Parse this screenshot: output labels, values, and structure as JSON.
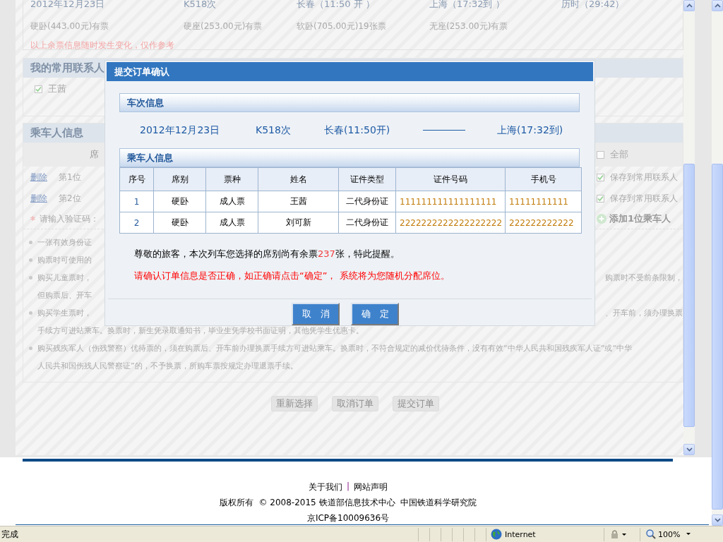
{
  "background_page": {
    "train_summary": {
      "date": "2012年12月23日",
      "train": "K518次",
      "depart": "长春（11:50 开 ）",
      "arrive": "上海（17:32到 ）",
      "duration": "历时（29:42）"
    },
    "seats": [
      "硬卧(443.00元)有票",
      "硬座(253.00元)有票",
      "软卧(705.00元)19张票",
      "无座(253.00元)有票"
    ],
    "seat_note": "以上余票信息随时发生变化，仅作参考",
    "contacts_section": {
      "title": "我的常用联系人",
      "contacts": [
        {
          "name": "王茜",
          "checked": true
        }
      ]
    },
    "passengers_section": {
      "title": "乘车人信息",
      "column_1": "席",
      "select_all": {
        "label": "全部",
        "checked": false
      },
      "rows": [
        {
          "delete": "删除",
          "position": "第1位",
          "save": {
            "label": "保存到常用联系人",
            "checked": true
          }
        },
        {
          "delete": "删除",
          "position": "第2位",
          "save": {
            "label": "保存到常用联系人",
            "checked": true
          }
        }
      ],
      "captcha_label": "请输入验证码：",
      "add_passenger": "添加1位乘车人"
    },
    "notes": [
      {
        "bullet": true,
        "left": "一张有效身份证"
      },
      {
        "bullet": true,
        "left": "购票时可使用的"
      },
      {
        "bullet": true,
        "left": "购买儿童票时，",
        "right": "购票时不受前条限制，"
      },
      {
        "bullet": false,
        "left": "但购票后、开车"
      },
      {
        "bullet": true,
        "left": "购买学生票时，",
        "right": "、开车前，须办理换票"
      },
      {
        "bullet": false,
        "left": "手续方可进站乘车。换票时，新生凭录取通知书，毕业生凭学校书面证明，其他凭学生优惠卡。"
      },
      {
        "bullet": true,
        "left": "购买残疾军人（伤残警察）优待票的，须在购票后、开车前办理换票手续方可进站乘车。换票时，不符合规定的减价优待条件，没有有效“中华人民共和国残疾军人证“或“中华"
      },
      {
        "bullet": false,
        "left": "人民共和国伤残人民警察证”的，不予换票，所购车票按规定办理退票手续。"
      }
    ],
    "buttons": [
      "重新选择",
      "取消订单",
      "提交订单"
    ]
  },
  "modal": {
    "title": "提交订单确认",
    "train_section": {
      "title": "车次信息",
      "date": "2012年12月23日",
      "train": "K518次",
      "depart": "长春(11:50开)",
      "arrive": "上海(17:32到)"
    },
    "passenger_section": {
      "title": "乘车人信息",
      "columns": [
        "序号",
        "席别",
        "票种",
        "姓名",
        "证件类型",
        "证件号码",
        "手机号"
      ],
      "rows": [
        [
          "1",
          "硬卧",
          "成人票",
          "王茜",
          "二代身份证",
          "111111111111111111",
          "11111111111"
        ],
        [
          "2",
          "硬卧",
          "成人票",
          "刘可新",
          "二代身份证",
          "2222222222222222222",
          "222222222222"
        ]
      ]
    },
    "notice": {
      "before": "尊敬的旅客，本次列车您选择的席别尚有余票",
      "count": "237",
      "after": "张，特此提醒。"
    },
    "warning": "请确认订单信息是否正确，如正确请点击“确定”， 系统将为您随机分配席位。",
    "buttons": [
      "取　消",
      "确　定"
    ]
  },
  "footer": {
    "links": [
      "关于我们",
      "网站声明"
    ],
    "separator": "|",
    "copyright": "版权所有  © 2008-2015 铁道部信息技术中心  中国铁道科学研究院",
    "icp": "京ICP备10009636号"
  },
  "status_bar": {
    "status": "完成",
    "zone": "Internet",
    "zoom": "100%"
  }
}
